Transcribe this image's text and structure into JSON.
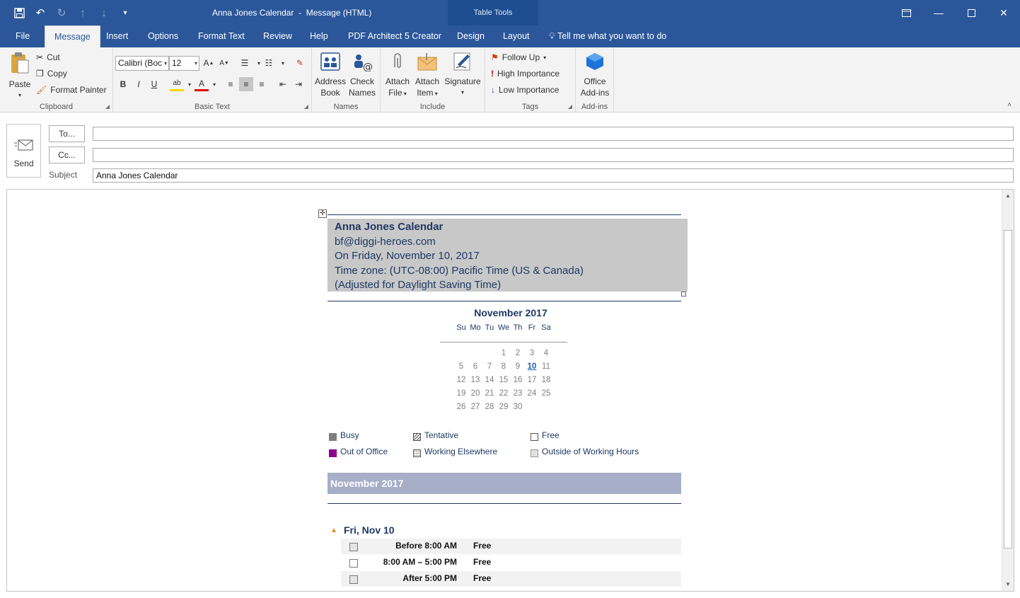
{
  "window": {
    "title": "Anna Jones Calendar  -  Message (HTML)",
    "contextual_label": "Table Tools",
    "accent": "#2b579a"
  },
  "qat": {
    "icons": [
      "save-icon",
      "undo-icon",
      "redo-icon",
      "up-icon",
      "down-icon",
      "customize-icon"
    ]
  },
  "tabs": [
    {
      "label": "File"
    },
    {
      "label": "Message"
    },
    {
      "label": "Insert"
    },
    {
      "label": "Options"
    },
    {
      "label": "Format Text"
    },
    {
      "label": "Review"
    },
    {
      "label": "Help"
    },
    {
      "label": "PDF Architect 5 Creator"
    },
    {
      "label": "Design"
    },
    {
      "label": "Layout"
    }
  ],
  "tell_me": "Tell me what you want to do",
  "ribbon": {
    "clipboard": {
      "label": "Clipboard",
      "paste": "Paste",
      "cut": "Cut",
      "copy": "Copy",
      "format_painter": "Format Painter"
    },
    "basic_text": {
      "label": "Basic Text",
      "font": "Calibri (Boc",
      "size": "12"
    },
    "names": {
      "label": "Names",
      "address_book_1": "Address",
      "address_book_2": "Book",
      "check_names_1": "Check",
      "check_names_2": "Names"
    },
    "include": {
      "label": "Include",
      "attach_file_1": "Attach",
      "attach_file_2": "File",
      "attach_item_1": "Attach",
      "attach_item_2": "Item",
      "signature": "Signature"
    },
    "tags": {
      "label": "Tags",
      "follow_up": "Follow Up",
      "high": "High Importance",
      "low": "Low Importance"
    },
    "addins": {
      "label": "Add-ins",
      "office_1": "Office",
      "office_2": "Add-ins"
    }
  },
  "compose": {
    "send": "Send",
    "to": "To...",
    "cc": "Cc...",
    "subject_label": "Subject",
    "to_value": "",
    "cc_value": "",
    "subject_value": "Anna Jones Calendar"
  },
  "body": {
    "header_lines": [
      "Anna Jones Calendar",
      "bf@diggi-heroes.com",
      "On Friday, November 10, 2017",
      "Time zone: (UTC-08:00) Pacific Time (US & Canada)",
      "(Adjusted for Daylight Saving Time)"
    ],
    "calendar": {
      "title": "November 2017",
      "days": [
        "Su",
        "Mo",
        "Tu",
        "We",
        "Th",
        "Fr",
        "Sa"
      ],
      "weeks": [
        [
          "",
          "",
          "",
          "1",
          "2",
          "3",
          "4"
        ],
        [
          "5",
          "6",
          "7",
          "8",
          "9",
          "10",
          "11"
        ],
        [
          "12",
          "13",
          "14",
          "15",
          "16",
          "17",
          "18"
        ],
        [
          "19",
          "20",
          "21",
          "22",
          "23",
          "24",
          "25"
        ],
        [
          "26",
          "27",
          "28",
          "29",
          "30",
          "",
          ""
        ]
      ],
      "today": "10"
    },
    "legend": [
      {
        "label": "Busy",
        "color": "#7f7f7f"
      },
      {
        "label": "Tentative",
        "color": "#ffffff"
      },
      {
        "label": "Free",
        "color": "#ffffff"
      },
      {
        "label": "Out of Office",
        "color": "#8b008b"
      },
      {
        "label": "Working Elsewhere",
        "color": "#ffffff"
      },
      {
        "label": "Outside of Working Hours",
        "color": "#e0e0e0"
      }
    ],
    "month_band": "November 2017",
    "day_heading": "Fri, Nov 10",
    "slots": [
      {
        "time": "Before 8:00 AM",
        "status": "Free"
      },
      {
        "time": "8:00 AM – 5:00 PM",
        "status": "Free"
      },
      {
        "time": "After 5:00 PM",
        "status": "Free"
      }
    ]
  }
}
